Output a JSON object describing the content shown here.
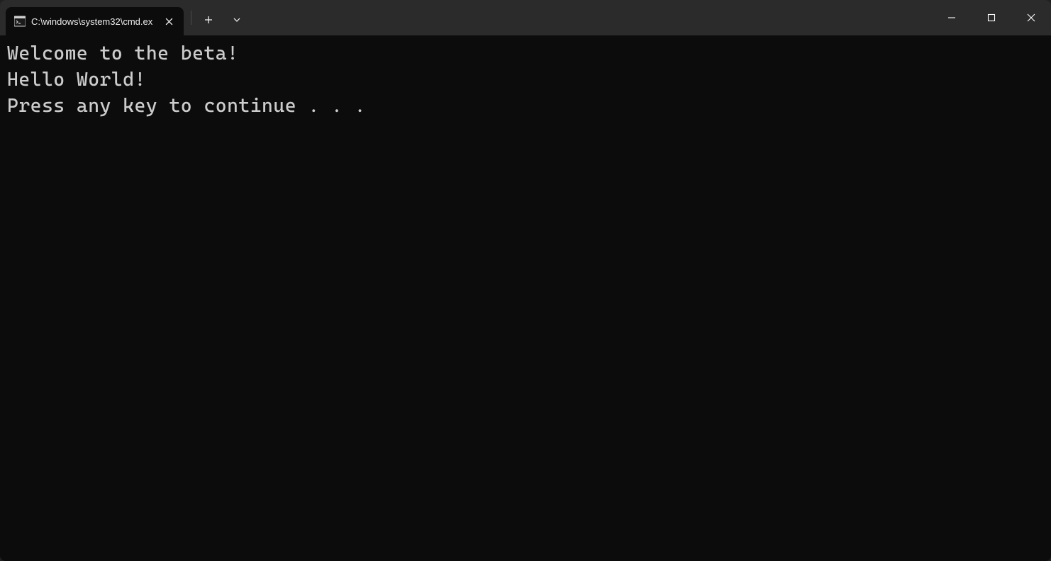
{
  "titlebar": {
    "tab": {
      "title": "C:\\windows\\system32\\cmd.ex",
      "icon": "cmd-icon"
    }
  },
  "terminal": {
    "lines": [
      "Welcome to the beta!",
      "Hello World!",
      "Press any key to continue . . ."
    ]
  }
}
